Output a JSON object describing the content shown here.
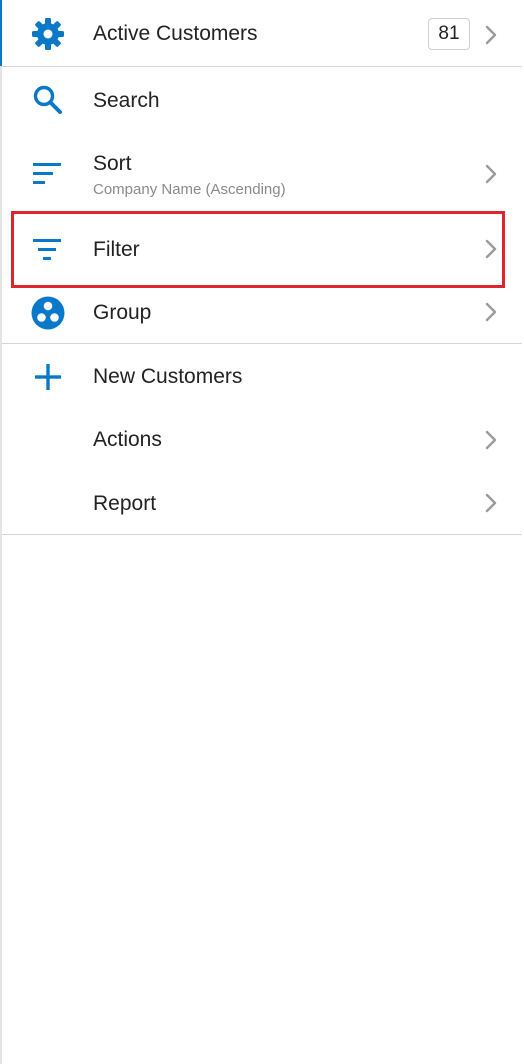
{
  "theme": {
    "accent_color": "#0a78c8",
    "highlight_color": "#e0242d",
    "text_color": "#222222",
    "subtext_color": "#8a8a8a",
    "chevron_color": "#9a9a9a"
  },
  "header": {
    "label": "Active Customers",
    "count": "81",
    "icon": "gear-icon"
  },
  "menu": {
    "search": {
      "label": "Search",
      "icon": "search-icon"
    },
    "sort": {
      "label": "Sort",
      "sublabel": "Company Name (Ascending)",
      "icon": "sort-icon"
    },
    "filter": {
      "label": "Filter",
      "icon": "filter-icon",
      "highlighted": true
    },
    "group": {
      "label": "Group",
      "icon": "group-icon"
    },
    "new_customers": {
      "label": "New Customers",
      "icon": "plus-icon"
    },
    "actions": {
      "label": "Actions"
    },
    "report": {
      "label": "Report"
    }
  }
}
